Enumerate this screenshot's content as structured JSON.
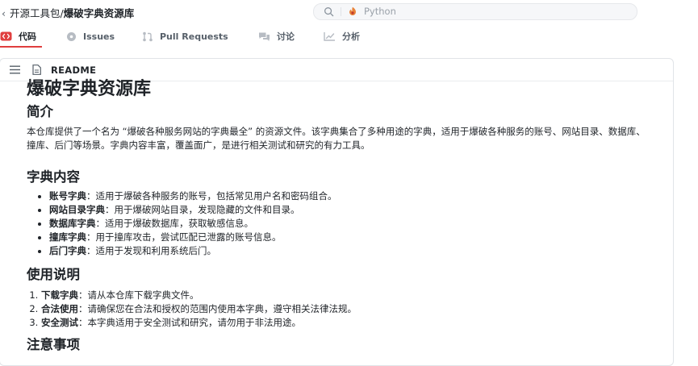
{
  "header": {
    "repo_prefix": "开源工具包/",
    "repo_name": "爆破字典资源库",
    "search_placeholder": "Python"
  },
  "tabs": [
    {
      "label": "代码",
      "icon": "code-icon",
      "active": true
    },
    {
      "label": "Issues",
      "icon": "issues-icon",
      "active": false
    },
    {
      "label": "Pull Requests",
      "icon": "pull-request-icon",
      "active": false
    },
    {
      "label": "讨论",
      "icon": "discussion-icon",
      "active": false
    },
    {
      "label": "分析",
      "icon": "analytics-icon",
      "active": false
    }
  ],
  "readme": {
    "label": "README",
    "title": "爆破字典资源库",
    "intro_heading": "简介",
    "intro_text": "本仓库提供了一个名为 “爆破各种服务网站的字典最全” 的资源文件。该字典集合了多种用途的字典，适用于爆破各种服务的账号、网站目录、数据库、撞库、后门等场景。字典内容丰富，覆盖面广，是进行相关测试和研究的有力工具。",
    "content_heading": "字典内容",
    "content_items": [
      {
        "term": "账号字典",
        "desc": "：适用于爆破各种服务的账号，包括常见用户名和密码组合。"
      },
      {
        "term": "网站目录字典",
        "desc": "：用于爆破网站目录，发现隐藏的文件和目录。"
      },
      {
        "term": "数据库字典",
        "desc": "：适用于爆破数据库，获取敏感信息。"
      },
      {
        "term": "撞库字典",
        "desc": "：用于撞库攻击，尝试匹配已泄露的账号信息。"
      },
      {
        "term": "后门字典",
        "desc": "：适用于发现和利用系统后门。"
      }
    ],
    "usage_heading": "使用说明",
    "usage_items": [
      {
        "term": "下载字典",
        "desc": "：请从本仓库下载字典文件。"
      },
      {
        "term": "合法使用",
        "desc": "：请确保您在合法和授权的范围内使用本字典，遵守相关法律法规。"
      },
      {
        "term": "安全测试",
        "desc": "：本字典适用于安全测试和研究，请勿用于非法用途。"
      }
    ],
    "notes_heading": "注意事项"
  },
  "colors": {
    "accent": "#e03e3e",
    "python_icon": "#e8833a"
  }
}
